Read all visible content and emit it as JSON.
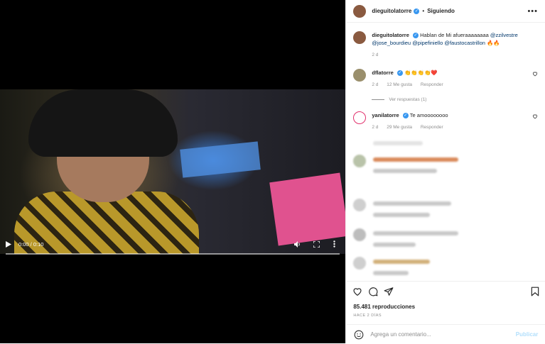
{
  "video": {
    "time_display": "0:00 / 0:10",
    "progress": 0.0,
    "icons": [
      "play-icon",
      "volume-icon",
      "fullscreen-icon",
      "more-vertical-icon"
    ]
  },
  "post": {
    "username": "dieguitolatorre",
    "follow_status": "Siguiendo",
    "separator": "•",
    "more": "•••",
    "caption": {
      "username": "dieguitolatorre",
      "text": "Hablan de Mi afueraaaaaaaa",
      "mentions": [
        "@zzilvestre",
        "@jose_bourdieu",
        "@pipefiniello",
        "@faustocastrillon"
      ],
      "emoji": "🔥🔥",
      "time": "2 d"
    },
    "comments": [
      {
        "username": "dflatorre",
        "text": "👏👏👏👏❤️",
        "time": "2 d",
        "likes": "12 Me gusta",
        "reply": "Responder",
        "view_replies": "Ver respuestas (1)"
      },
      {
        "username": "yanilatorre",
        "text": "Te amoooooooo",
        "time": "2 d",
        "likes": "29 Me gusta",
        "reply": "Responder"
      }
    ],
    "views": "85.481 reproducciones",
    "posted_ago": "HACE 2 DÍAS",
    "add_comment_placeholder": "Agrega un comentario...",
    "publish_label": "Publicar"
  },
  "colors": {
    "verified": "#3897f0",
    "publish_disabled": "#b2dffc",
    "mention": "#00376b",
    "meta": "#8e8e8e"
  }
}
